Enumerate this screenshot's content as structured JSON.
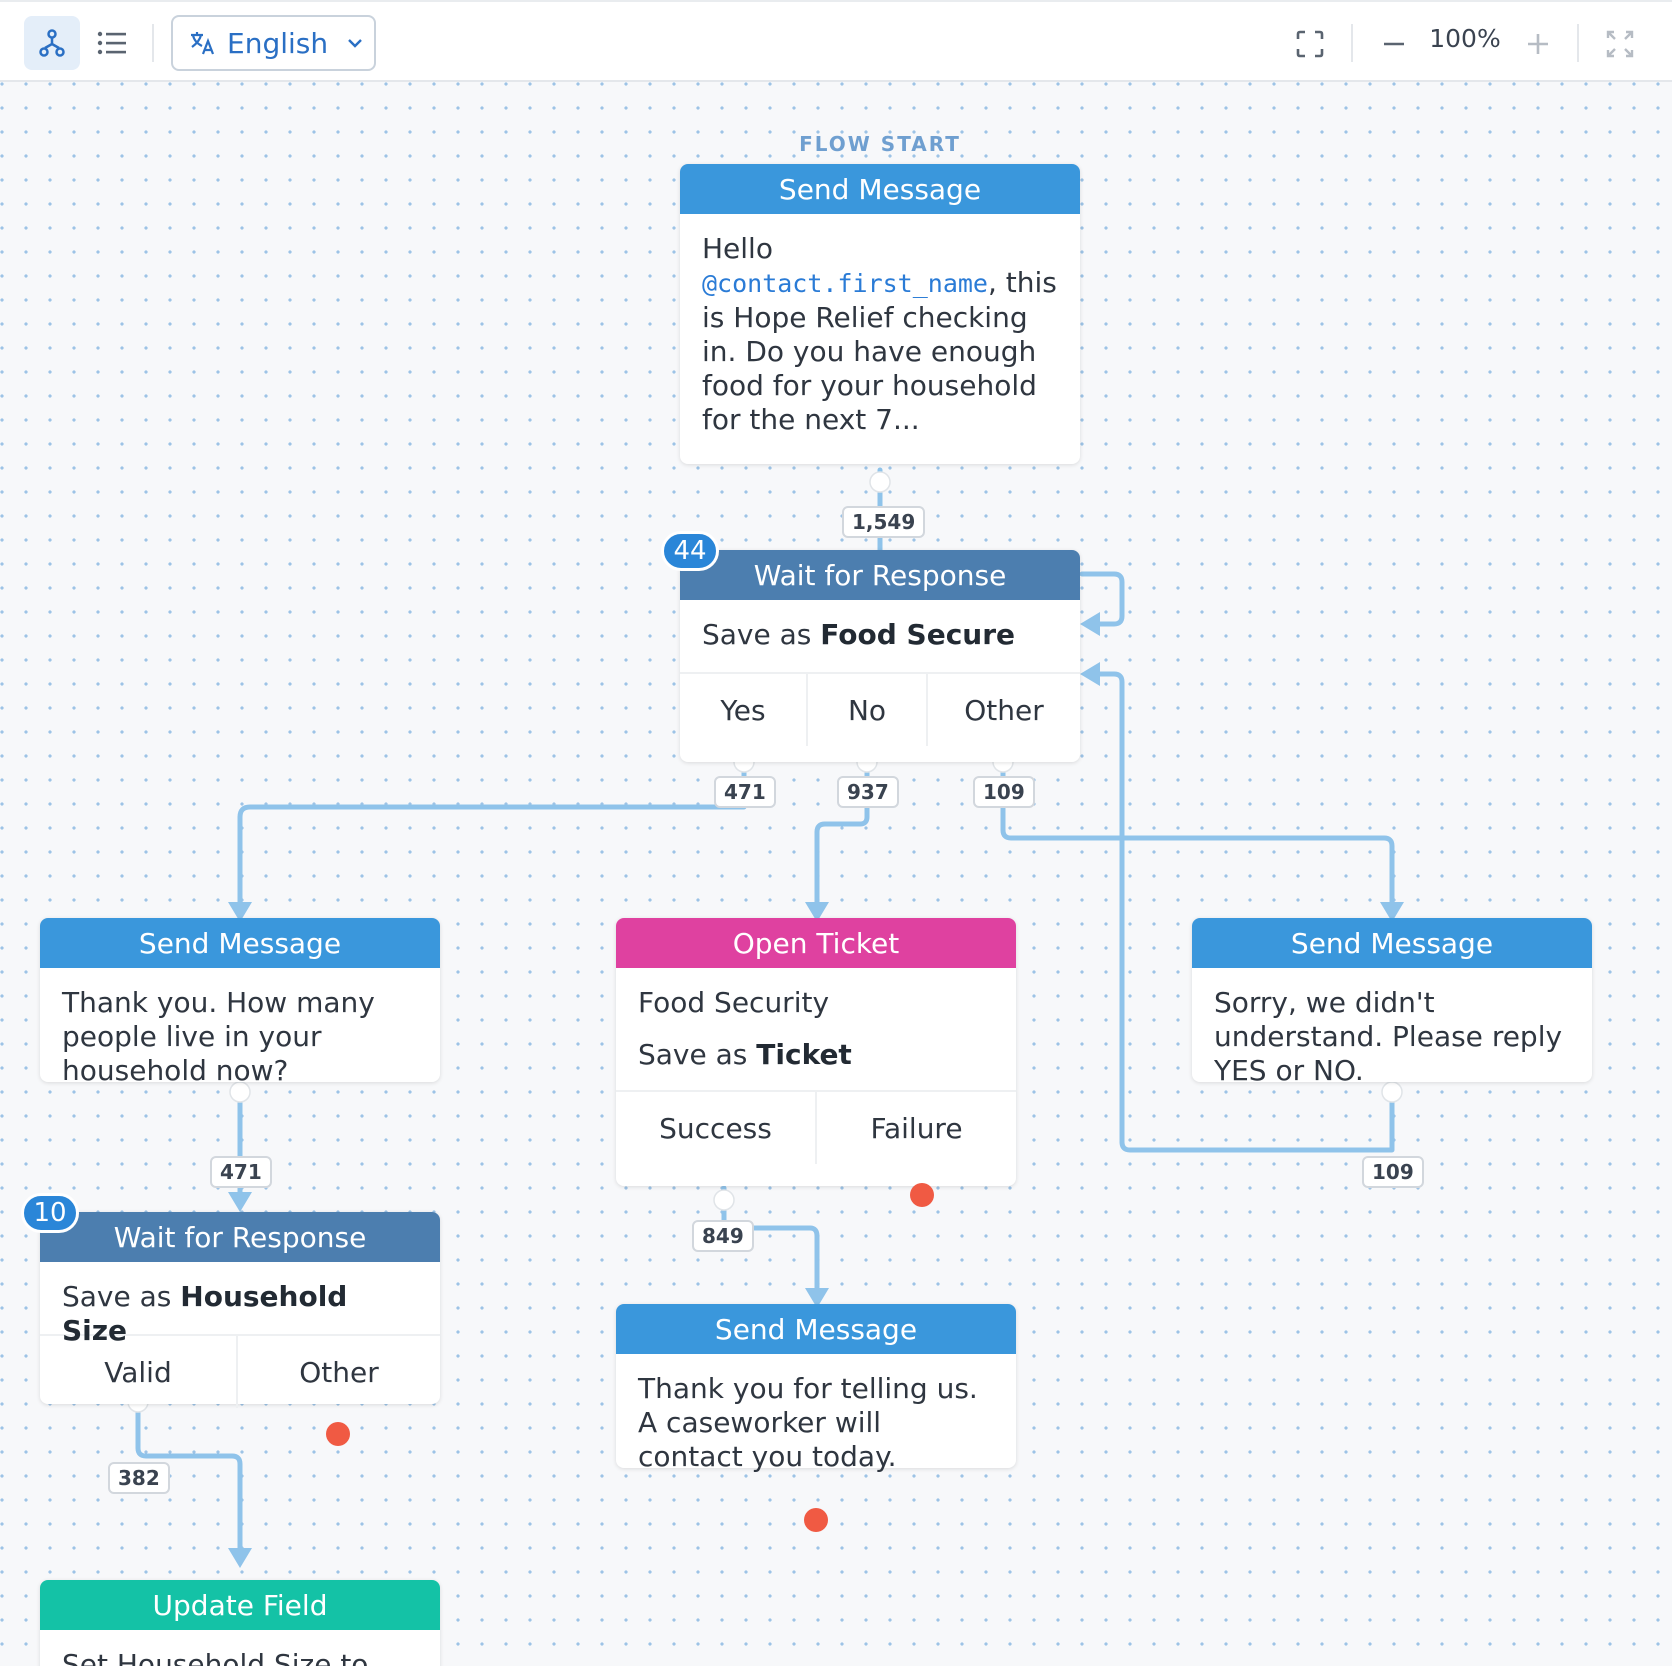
{
  "toolbar": {
    "language": "English",
    "zoom": "100%",
    "icons": [
      "flow-view-icon",
      "list-view-icon",
      "translate-icon",
      "chevron-down-icon",
      "fit-screen-icon",
      "zoom-out-icon",
      "zoom-in-icon",
      "fullscreen-icon"
    ]
  },
  "flow": {
    "start_label": "FLOW START",
    "nodes": {
      "start_message": {
        "title": "Send Message",
        "text_before": "Hello ",
        "variable": "@contact.first_name",
        "text_after": ", this is Hope Relief checking in. Do you have enough food for your household for the next 7..."
      },
      "wait_food": {
        "title": "Wait for Response",
        "badge": "44",
        "save_prefix": "Save as ",
        "save_name": "Food Secure",
        "cases": [
          "Yes",
          "No",
          "Other"
        ]
      },
      "msg_household": {
        "title": "Send Message",
        "text": "Thank you. How many people live in your household now?"
      },
      "open_ticket": {
        "title": "Open Ticket",
        "topic": "Food Security",
        "save_prefix": "Save as ",
        "save_name": "Ticket",
        "cases": [
          "Success",
          "Failure"
        ]
      },
      "msg_sorry": {
        "title": "Send Message",
        "text": "Sorry, we didn't understand. Please reply YES or NO."
      },
      "wait_household": {
        "title": "Wait for Response",
        "badge": "10",
        "save_prefix": "Save as ",
        "save_name": "Household Size",
        "cases": [
          "Valid",
          "Other"
        ]
      },
      "msg_thanks": {
        "title": "Send Message",
        "text": "Thank you for telling us. A caseworker will contact you today."
      },
      "update_field": {
        "title": "Update Field",
        "text": "Set Household Size to"
      }
    },
    "counts": {
      "start_to_wait": "1,549",
      "yes": "471",
      "no": "937",
      "other": "109",
      "household_msg": "471",
      "sorry_msg": "109",
      "ticket_success": "849",
      "valid": "382"
    },
    "colors": {
      "send_message": "#3a97dc",
      "wait_for_response": "#4c7eaf",
      "open_ticket": "#df41a0",
      "update_field": "#14c2a6",
      "link": "#8fc3ea",
      "inactive_exit": "#f05a43"
    }
  }
}
